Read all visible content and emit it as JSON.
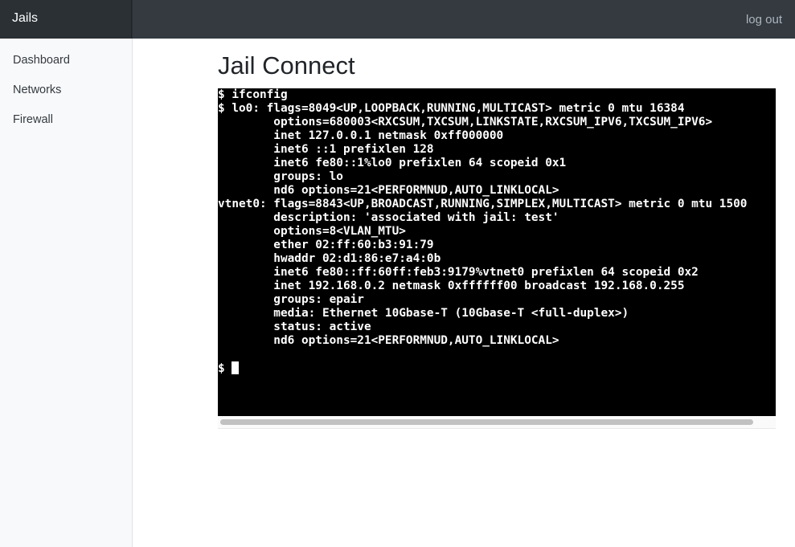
{
  "header": {
    "brand": "Jails",
    "logout_label": "log out"
  },
  "sidebar": {
    "items": [
      {
        "label": "Dashboard"
      },
      {
        "label": "Networks"
      },
      {
        "label": "Firewall"
      }
    ]
  },
  "main": {
    "title": "Jail Connect"
  },
  "terminal": {
    "lines": [
      "$ ifconfig",
      "$ lo0: flags=8049<UP,LOOPBACK,RUNNING,MULTICAST> metric 0 mtu 16384",
      "        options=680003<RXCSUM,TXCSUM,LINKSTATE,RXCSUM_IPV6,TXCSUM_IPV6>",
      "        inet 127.0.0.1 netmask 0xff000000",
      "        inet6 ::1 prefixlen 128",
      "        inet6 fe80::1%lo0 prefixlen 64 scopeid 0x1",
      "        groups: lo",
      "        nd6 options=21<PERFORMNUD,AUTO_LINKLOCAL>",
      "vtnet0: flags=8843<UP,BROADCAST,RUNNING,SIMPLEX,MULTICAST> metric 0 mtu 1500",
      "        description: 'associated with jail: test'",
      "        options=8<VLAN_MTU>",
      "        ether 02:ff:60:b3:91:79",
      "        hwaddr 02:d1:86:e7:a4:0b",
      "        inet6 fe80::ff:60ff:feb3:9179%vtnet0 prefixlen 64 scopeid 0x2",
      "        inet 192.168.0.2 netmask 0xffffff00 broadcast 192.168.0.255",
      "        groups: epair",
      "        media: Ethernet 10Gbase-T (10Gbase-T <full-duplex>)",
      "        status: active",
      "        nd6 options=21<PERFORMNUD,AUTO_LINKLOCAL>",
      ""
    ],
    "prompt": "$ "
  },
  "colors": {
    "topbar": "#343a40",
    "brand_bg": "#2b3035",
    "sidebar_bg": "#f8f9fa",
    "terminal_bg": "#000000",
    "terminal_fg": "#ffffff"
  }
}
